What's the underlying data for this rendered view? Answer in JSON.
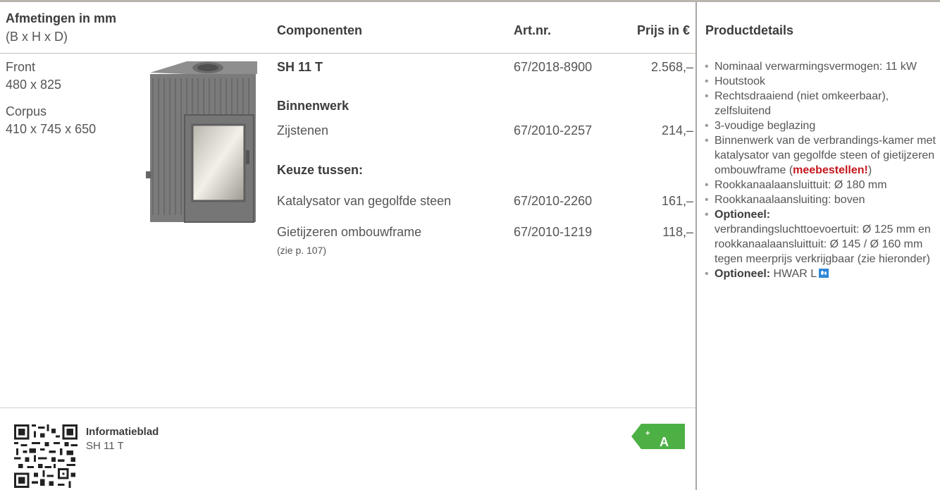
{
  "headers": {
    "dimensions_title": "Afmetingen in mm",
    "dimensions_sub": "(B x H x D)",
    "components": "Componenten",
    "artnr": "Art.nr.",
    "price": "Prijs in €",
    "details": "Productdetails"
  },
  "dimensions": {
    "front_label": "Front",
    "front_value": "480 x 825",
    "corpus_label": "Corpus",
    "corpus_value": "410 x 745 x 650"
  },
  "rows": [
    {
      "component": "SH 11 T",
      "artnr": "67/2018-8900",
      "price": "2.568,–"
    },
    {
      "section": "Binnenwerk"
    },
    {
      "component": "Zijstenen",
      "artnr": "67/2010-2257",
      "price": "214,–"
    },
    {
      "section": "Keuze tussen:"
    },
    {
      "component": "Katalysator van gegolfde steen",
      "artnr": "67/2010-2260",
      "price": "161,–"
    },
    {
      "component": "Gietijzeren ombouwframe",
      "note": "(zie p. 107)",
      "artnr": "67/2010-1219",
      "price": "118,–"
    }
  ],
  "details": {
    "d1": "Nominaal verwarmingsvermogen: 11 kW",
    "d2": "Houtstook",
    "d3": "Rechtsdraaiend (niet omkeerbaar), zelfsluitend",
    "d4": "3-voudige beglazing",
    "d5_a": "Binnenwerk van de verbrandings-kamer met katalysator van gegolfde steen of gietijzeren ombouwframe (",
    "d5_red": "meebestellen!",
    "d5_b": ")",
    "d6": "Rookkanaalaansluittuit: Ø 180 mm",
    "d7": "Rookkanaalaansluiting: boven",
    "d8_bold": "Optioneel:",
    "d8_text": "verbrandingsluchttoevoertuit: Ø 125 mm en rookkanaalaansluittuit: Ø 145 / Ø 160 mm tegen meerprijs verkrijgbaar (zie hieronder)",
    "d9_bold": "Optioneel:",
    "d9_text": " HWAR L",
    "d9_icon": "water-drops-icon"
  },
  "footer": {
    "info_title": "Informatieblad",
    "info_sub": "SH 11 T",
    "energy_class": "A",
    "energy_sup": "+",
    "energy_color": "#4db044"
  }
}
